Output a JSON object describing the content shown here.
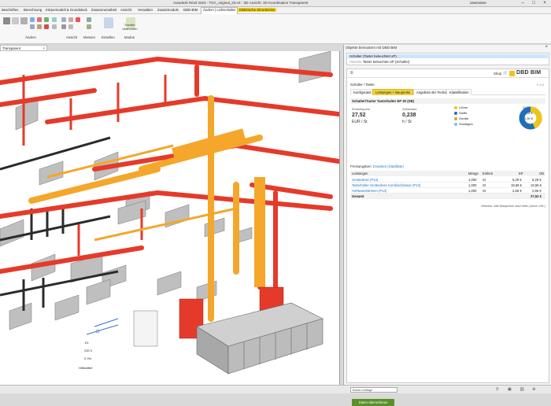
{
  "titlebar": {
    "title": "Autodesk Revit 2023 - TGA_original_23.rvt - 3D-Ansicht: 3D Koordination Transparent",
    "user": "Username"
  },
  "menu": {
    "items": [
      "Beschriften",
      "Berechnung",
      "Körpermodell & Grundstück",
      "Zusammenarbeit",
      "Ansicht",
      "Verwalten",
      "Zusatzmodule",
      "DBD-BIM",
      "Ändern | Lichtschalter",
      "Elektrische Stromkreise"
    ]
  },
  "ribbon": {
    "panel_labels": [
      "Ändern",
      "Ansicht",
      "Messen",
      "Erstellen",
      "Modus"
    ],
    "family_edit": "Familie bearbeiten"
  },
  "view": {
    "tab_label": "Transparent",
    "labels": {
      "e1": "E1",
      "v": "230 V",
      "vn": "0 V/n",
      "hpe": "Hilfsmittel"
    }
  },
  "panel": {
    "title": "Objekte bemustern mit DBD BIM",
    "tree": {
      "row1": "Schalter (Taster beleuchtet UP)",
      "row2_prefix": "Variante",
      "row2": "Taster beleuchtet UP (Schalter)"
    },
    "web": {
      "shop": "Shop",
      "logo": "DBD BIM",
      "breadcrumb": "Schalter / Taster",
      "version": "V 4.0",
      "tabs": [
        "Konfigurator",
        "Leistungen + Baupreise",
        "Angebote der Technik",
        "Klassifikation"
      ],
      "section_title": "Schalter/Taster Tasterhalter EP 30 (SB)",
      "unit_price_label": "Einheitspreis",
      "unit_price": "27,52",
      "unit_price_unit": "EUR / St",
      "time_label": "Zeitansatz",
      "time_value": "0,238",
      "time_unit": "h / St",
      "cost_split": [
        {
          "name": "Löhne",
          "value": "11,98 €",
          "color": "#f0c419"
        },
        {
          "name": "Stoffe",
          "value": "15,54 €",
          "color": "#1f6fb5"
        },
        {
          "name": "Geräte",
          "value": "0,00 €",
          "color": "#e8a020"
        },
        {
          "name": "Sonstiges",
          "value": "0,00 €",
          "color": "#8fbbe0"
        }
      ],
      "price_link_label": "Preisangaben:",
      "price_link_value": "Erwarten (Stadtliste)",
      "table_headers": [
        "Leistungen",
        "Menge",
        "Einheit",
        "EP",
        "GB"
      ],
      "rows": [
        {
          "name": "Gerätedose (P13)",
          "qty": "1,000",
          "unit": "St",
          "ep": "6,29 €",
          "gb": "6,29 €"
        },
        {
          "name": "Tasterhalter Gerätedose Kombischlampe (P13)",
          "qty": "1,000",
          "unit": "St",
          "ep": "18,59 €",
          "gb": "18,59 €"
        },
        {
          "name": "Hohlwandrahmen (P13)",
          "qty": "1,000",
          "unit": "St",
          "ep": "2,65 €",
          "gb": "2,65 €"
        }
      ],
      "total_label": "Gesamt",
      "total_value": "27,52 €",
      "note": "Hinweis: Alle Baupreise sind netto (ohne USt.)",
      "apply_button": "Daten übernehmen"
    }
  },
  "status": {
    "select": "Basis-Leitlage"
  },
  "colors": {
    "red_duct": "#e53a2a",
    "orange_duct": "#f4a72a",
    "accent_yellow": "#f2d040"
  }
}
